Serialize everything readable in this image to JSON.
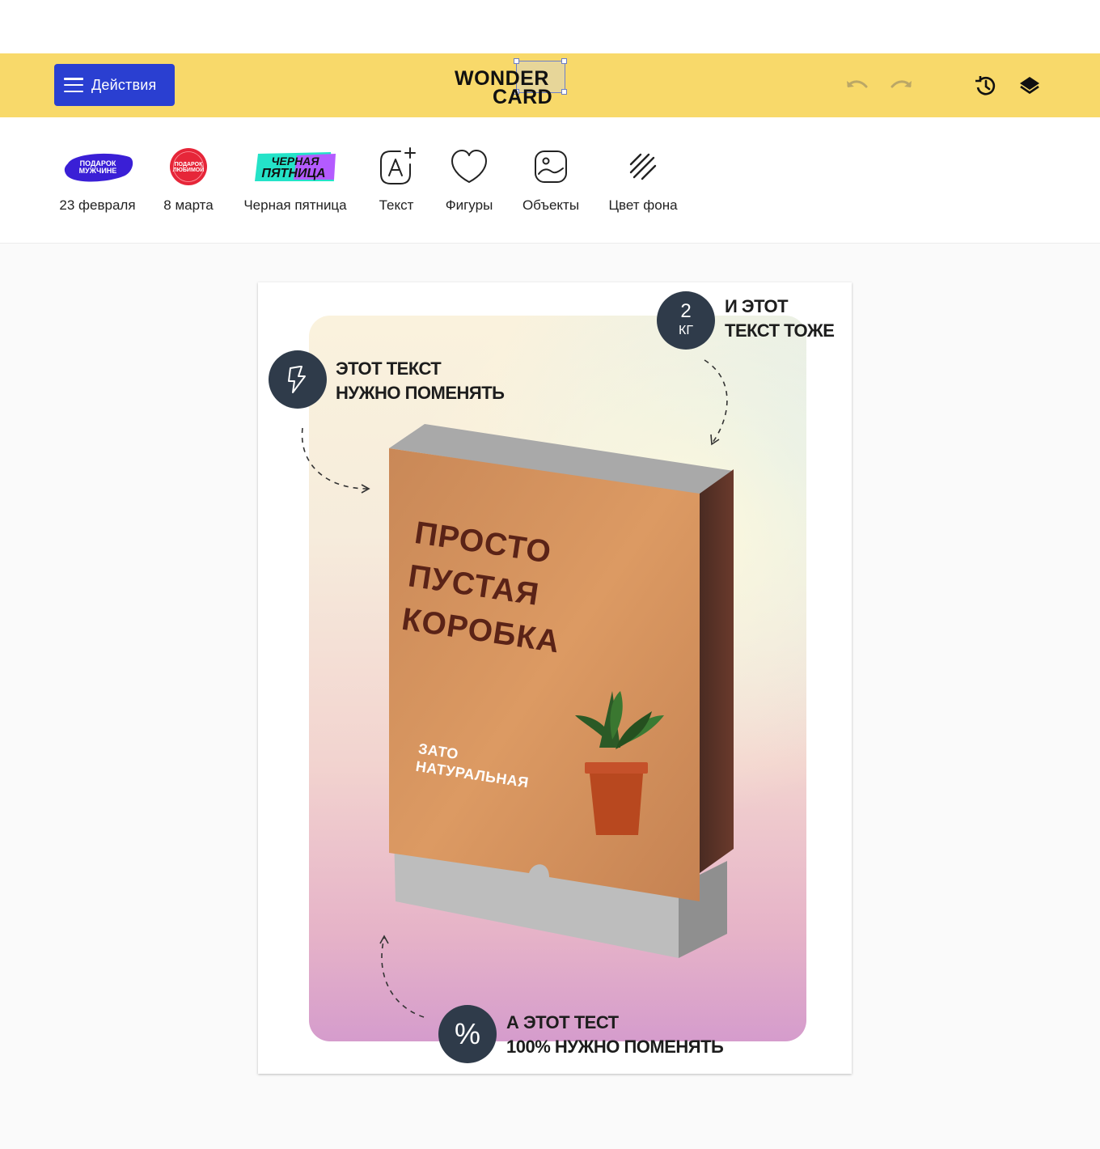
{
  "header": {
    "actions_label": "Действия",
    "logo_line1": "WONDER",
    "logo_line2": "CARD",
    "colors": {
      "header_bg": "#f8d96a",
      "actions_bg": "#2a3fd1"
    },
    "icons": [
      "undo-icon",
      "redo-icon",
      "history-icon",
      "layers-icon"
    ]
  },
  "toolbar": {
    "items": [
      {
        "label": "23 февраля",
        "icon": "podarok-muzhchine-sticker",
        "sticker_text": "ПОДАРОК МУЖЧИНЕ"
      },
      {
        "label": "8 марта",
        "icon": "podarok-lubimoy-sticker",
        "sticker_text": "ПОДАРОК ЛЮБИМОЙ"
      },
      {
        "label": "Черная пятница",
        "icon": "black-friday-sticker",
        "sticker_text": "ЧЕРНАЯ ПЯТНИЦА"
      },
      {
        "label": "Текст",
        "icon": "add-text-icon"
      },
      {
        "label": "Фигуры",
        "icon": "heart-shape-icon"
      },
      {
        "label": "Объекты",
        "icon": "image-object-icon"
      },
      {
        "label": "Цвет фона",
        "icon": "background-stripes-icon"
      }
    ]
  },
  "card": {
    "callout_top_left": {
      "line1": "ЭТОТ ТЕКСТ",
      "line2": "НУЖНО ПОМЕНЯТЬ",
      "icon": "lightning-icon"
    },
    "callout_top_right": {
      "line1": "И ЭТОТ",
      "line2": "ТЕКСТ ТОЖЕ",
      "badge_value": "2",
      "badge_unit": "КГ"
    },
    "callout_bottom": {
      "line1": "А ЭТОТ ТЕСТ",
      "line2": "100% НУЖНО ПОМЕНЯТЬ",
      "badge_symbol": "%"
    },
    "box": {
      "title_line1": "ПРОСТО",
      "title_line2": "ПУСТАЯ",
      "title_line3": "КОРОБКА",
      "subtitle_line1": "ЗАТО",
      "subtitle_line2": "НАТУРАЛЬНАЯ"
    }
  }
}
